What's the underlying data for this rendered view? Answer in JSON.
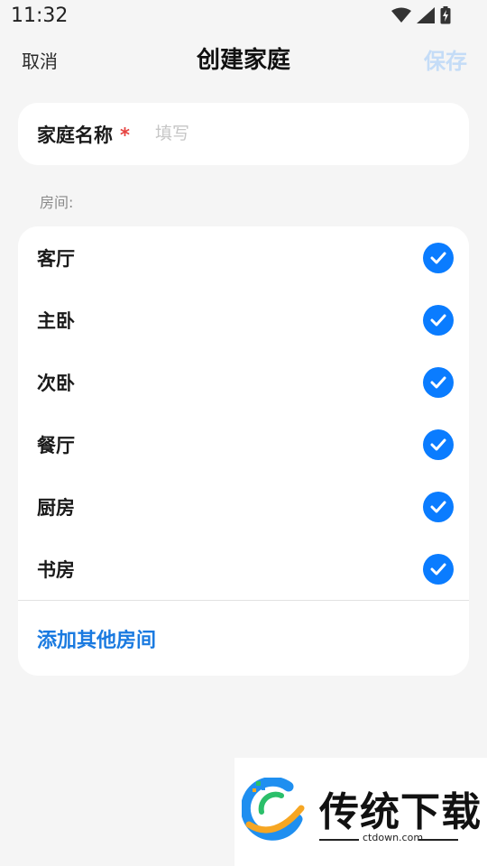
{
  "status_bar": {
    "time": "11:32",
    "icons": [
      "wifi-icon",
      "signal-icon",
      "battery-charging-icon"
    ]
  },
  "header": {
    "cancel_label": "取消",
    "title": "创建家庭",
    "save_label": "保存"
  },
  "family_name": {
    "label": "家庭名称",
    "required_mark": "*",
    "placeholder": "填写",
    "value": ""
  },
  "rooms": {
    "section_label": "房间:",
    "items": [
      {
        "label": "客厅",
        "checked": true
      },
      {
        "label": "主卧",
        "checked": true
      },
      {
        "label": "次卧",
        "checked": true
      },
      {
        "label": "餐厅",
        "checked": true
      },
      {
        "label": "厨房",
        "checked": true
      },
      {
        "label": "书房",
        "checked": true
      }
    ],
    "add_label": "添加其他房间"
  },
  "watermark": {
    "name": "传统下载",
    "url": "ctdown.com"
  },
  "colors": {
    "accent": "#0a7cff",
    "link": "#1a7ae0",
    "save_disabled": "#c4dcf7",
    "required": "#e64340",
    "background": "#f5f5f5"
  }
}
